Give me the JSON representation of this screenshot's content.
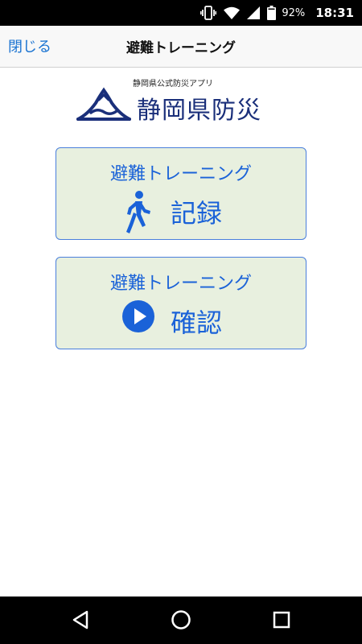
{
  "status_bar": {
    "icons": [
      "vibrate-icon",
      "wifi-icon",
      "signal-icon",
      "battery-icon"
    ],
    "battery_percent": "92%",
    "time": "18:31"
  },
  "header": {
    "close_label": "閉じる",
    "title": "避難トレーニング"
  },
  "logo": {
    "tagline": "静岡県公式防災アプリ",
    "name": "静岡県防災",
    "color": "#1a2f7a"
  },
  "cards": [
    {
      "title": "避難トレーニング",
      "label": "記録",
      "icon": "walking-person-icon"
    },
    {
      "title": "避難トレーニング",
      "label": "確認",
      "icon": "play-circle-icon"
    }
  ],
  "nav_bar": {
    "icons": [
      "back-icon",
      "home-icon",
      "recents-icon"
    ]
  },
  "colors": {
    "accent": "#1a62d8",
    "card_background": "#e8f0df",
    "card_border": "#4a7fdc"
  }
}
